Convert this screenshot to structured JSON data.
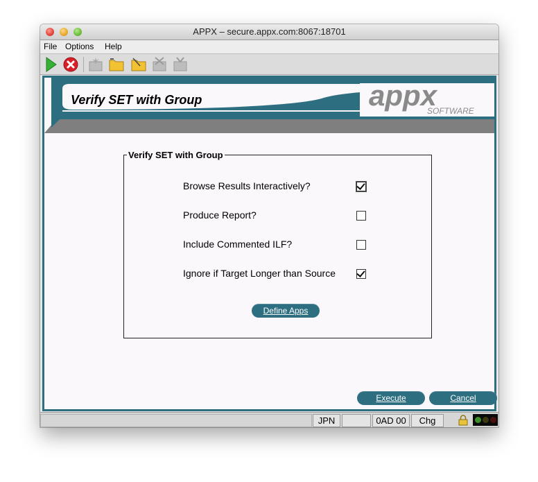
{
  "window": {
    "title": "APPX – secure.appx.com:8067:18701"
  },
  "menu": {
    "items": [
      "File",
      "Options",
      "Help"
    ]
  },
  "toolbar": {
    "buttons": [
      {
        "name": "run-icon"
      },
      {
        "name": "stop-icon"
      },
      {
        "name": "new-icon"
      },
      {
        "name": "open-folder-icon"
      },
      {
        "name": "edit-folder-icon"
      },
      {
        "name": "delete-icon"
      },
      {
        "name": "tv-icon"
      }
    ]
  },
  "banner": {
    "title": "Verify SET with Group",
    "logo_text": "appx",
    "logo_sub": "SOFTWARE"
  },
  "form": {
    "group_title": "Verify SET with Group",
    "fields": [
      {
        "label": "Browse Results Interactively?",
        "checked": true
      },
      {
        "label": "Produce Report?",
        "checked": false
      },
      {
        "label": "Include Commented ILF?",
        "checked": false
      },
      {
        "label": "Ignore if Target Longer than Source",
        "checked": true
      }
    ],
    "define_apps_label": "Define Apps"
  },
  "actions": {
    "execute_label": "Execute",
    "cancel_label": "Cancel"
  },
  "status": {
    "lang": "JPN",
    "blank": "",
    "code": "0AD 00",
    "mode": "Chg"
  },
  "colors": {
    "accent": "#2d6f81",
    "background": "#fbf8fb"
  }
}
